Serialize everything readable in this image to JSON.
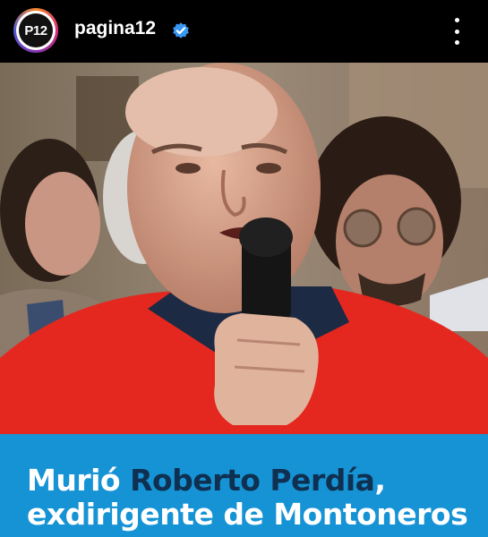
{
  "post": {
    "avatar_text": "P12",
    "username": "pagina12",
    "verified_icon": "verified-badge-icon",
    "more_icon": "more-options-icon"
  },
  "photo": {
    "subject": "man-speaking-into-microphone-photo"
  },
  "headline": {
    "part1": "Murió ",
    "highlight": "Roberto Perdía",
    "part2": ",",
    "line2": "exdirigente de Montoneros"
  },
  "colors": {
    "banner": "#1693d4",
    "highlight": "#0f3050",
    "verified": "#3897f0"
  }
}
